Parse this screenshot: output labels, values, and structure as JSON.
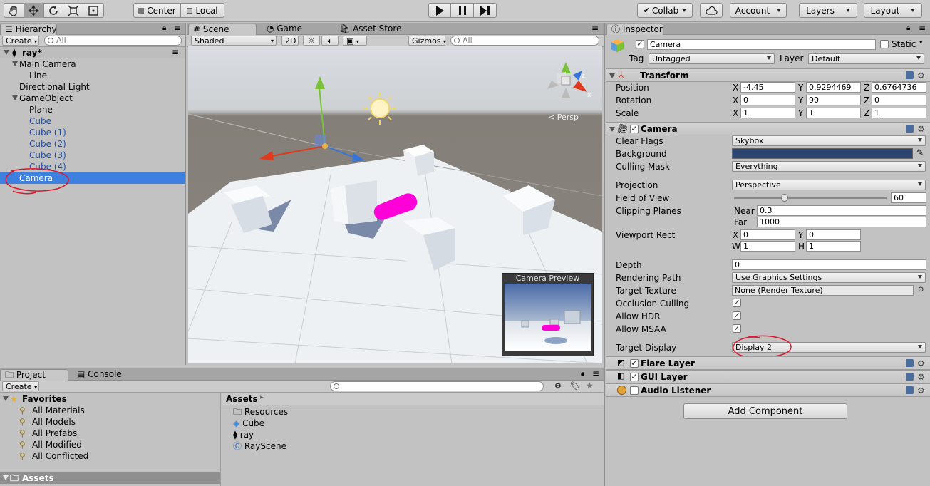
{
  "toolbar": {
    "pivot": "Center",
    "space": "Local",
    "collab": "Collab",
    "account": "Account",
    "layers": "Layers",
    "layout": "Layout"
  },
  "hierarchy": {
    "tab": "Hierarchy",
    "create": "Create",
    "search_placeholder": "All",
    "scene": "ray*",
    "items": [
      {
        "label": "Main Camera"
      },
      {
        "label": "Line"
      },
      {
        "label": "Directional Light"
      },
      {
        "label": "GameObject"
      },
      {
        "label": "Plane"
      },
      {
        "label": "Cube"
      },
      {
        "label": "Cube (1)"
      },
      {
        "label": "Cube (2)"
      },
      {
        "label": "Cube (3)"
      },
      {
        "label": "Cube (4)"
      },
      {
        "label": "Camera"
      }
    ]
  },
  "scene_view": {
    "tabs": [
      "Scene",
      "Game",
      "Asset Store"
    ],
    "shading": "Shaded",
    "mode2d": "2D",
    "gizmos": "Gizmos",
    "search_placeholder": "All",
    "persp": "Persp",
    "axis_x": "x",
    "axis_z": "z",
    "preview_title": "Camera Preview"
  },
  "project": {
    "tabs": [
      "Project",
      "Console"
    ],
    "create": "Create",
    "favorites": "Favorites",
    "favorite_items": [
      "All Materials",
      "All Models",
      "All Prefabs",
      "All Modified",
      "All Conflicted"
    ],
    "assets_root": "Assets",
    "breadcrumb": "Assets",
    "assets": [
      "Resources",
      "Cube",
      "ray",
      "RayScene"
    ]
  },
  "inspector": {
    "tab": "Inspector",
    "name": "Camera",
    "static": "Static",
    "tag_label": "Tag",
    "tag": "Untagged",
    "layer_label": "Layer",
    "layer": "Default",
    "transform": {
      "title": "Transform",
      "position": {
        "label": "Position",
        "x": "-4.45",
        "y": "0.9294469",
        "z": "0.6764736"
      },
      "rotation": {
        "label": "Rotation",
        "x": "0",
        "y": "90",
        "z": "0"
      },
      "scale": {
        "label": "Scale",
        "x": "1",
        "y": "1",
        "z": "1"
      }
    },
    "camera": {
      "title": "Camera",
      "clear_flags_label": "Clear Flags",
      "clear_flags": "Skybox",
      "background_label": "Background",
      "background_color": "#2b4470",
      "culling_mask_label": "Culling Mask",
      "culling_mask": "Everything",
      "projection_label": "Projection",
      "projection": "Perspective",
      "fov_label": "Field of View",
      "fov": "60",
      "fov_fraction": 0.33,
      "clipping_label": "Clipping Planes",
      "near_label": "Near",
      "near": "0.3",
      "far_label": "Far",
      "far": "1000",
      "viewport_label": "Viewport Rect",
      "vx": "0",
      "vy": "0",
      "vw": "1",
      "vh": "1",
      "depth_label": "Depth",
      "depth": "0",
      "rendering_path_label": "Rendering Path",
      "rendering_path": "Use Graphics Settings",
      "target_texture_label": "Target Texture",
      "target_texture": "None (Render Texture)",
      "occlusion_label": "Occlusion Culling",
      "hdr_label": "Allow HDR",
      "msaa_label": "Allow MSAA",
      "target_display_label": "Target Display",
      "target_display": "Display 2"
    },
    "flare": "Flare Layer",
    "gui": "GUI Layer",
    "audio": "Audio Listener",
    "add_component": "Add Component"
  },
  "axes": {
    "x": "X",
    "y": "Y",
    "z": "Z",
    "w": "W",
    "h": "H"
  },
  "colors": {
    "selection": "#3d80df",
    "annotation": "#e0142c",
    "magenta": "#ff00d8"
  }
}
